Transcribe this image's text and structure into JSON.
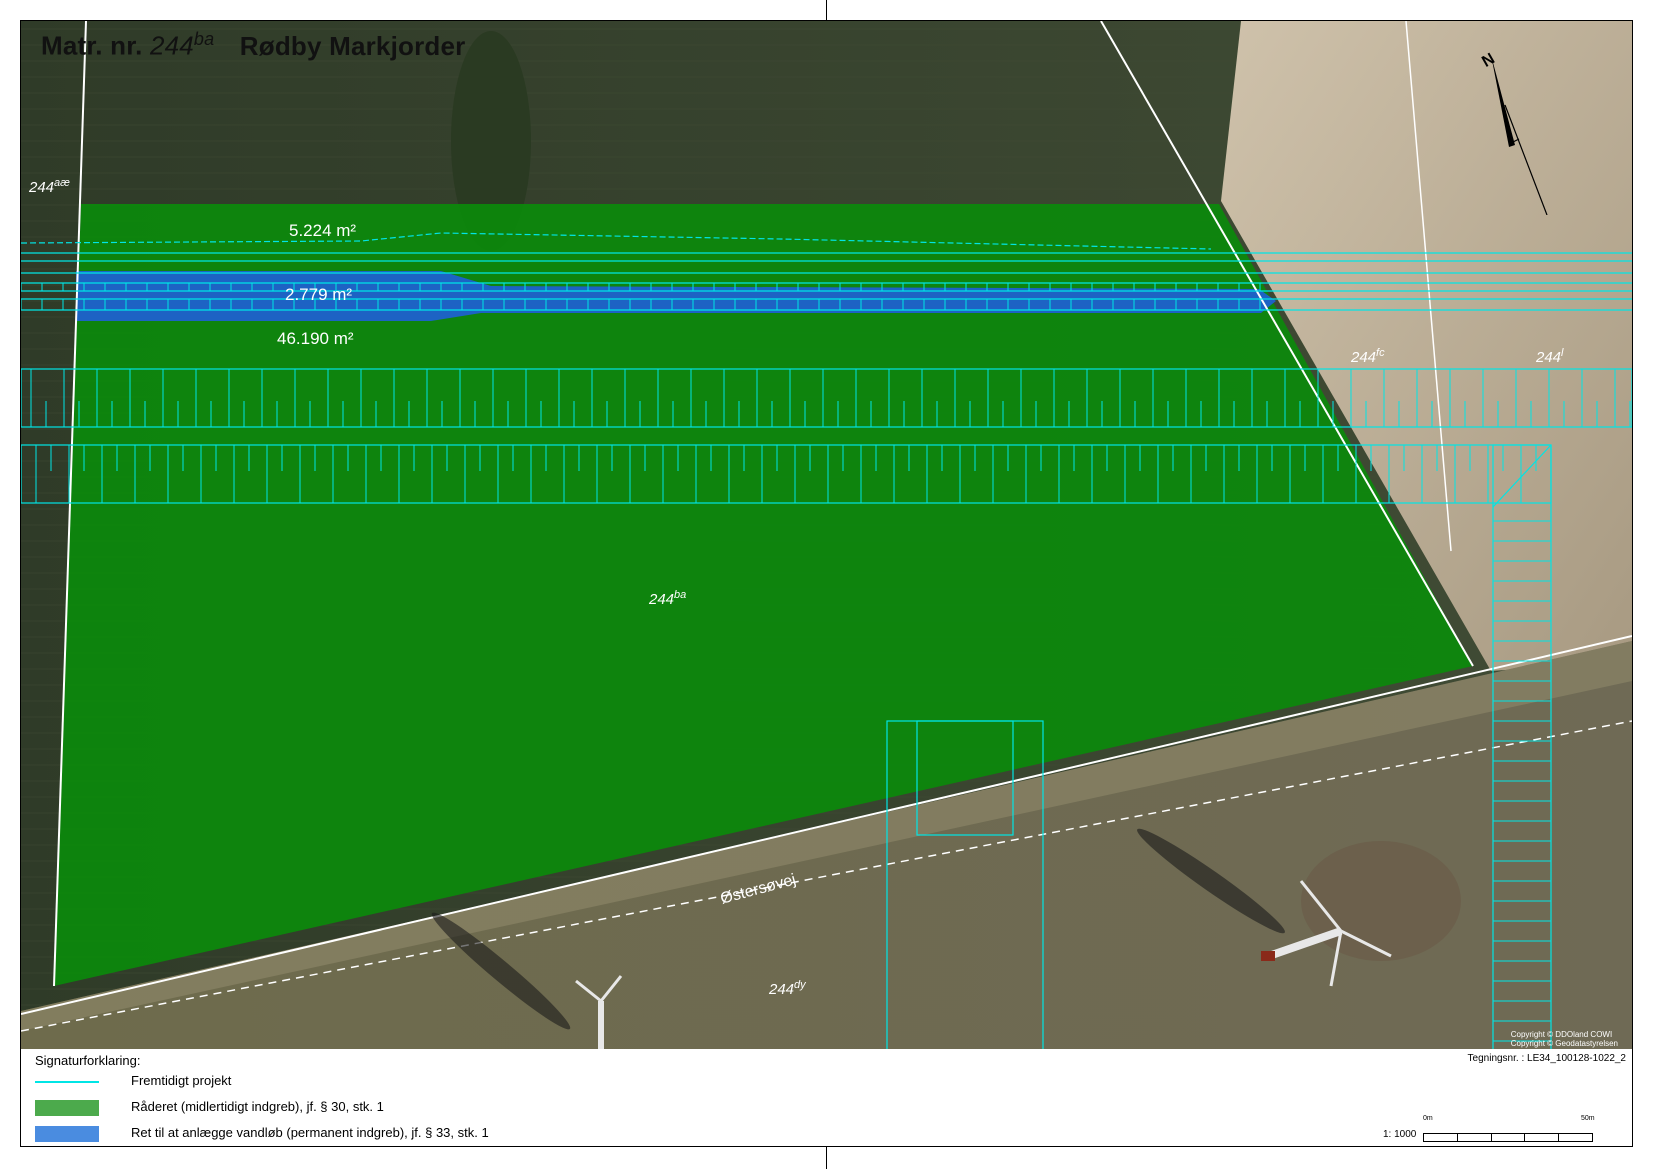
{
  "title": {
    "prefix": "Matr. nr.",
    "number": "244",
    "number_sup": "ba",
    "place": "Rødby Markjorder"
  },
  "parcels": [
    {
      "num": "244",
      "sup": "aæ"
    },
    {
      "num": "244",
      "sup": "fc"
    },
    {
      "num": "244",
      "sup": "l"
    },
    {
      "num": "244",
      "sup": "ba"
    },
    {
      "num": "244",
      "sup": "dy"
    }
  ],
  "areas": {
    "upper_strip": "5.224 m²",
    "watercourse": "2.779 m²",
    "main_field": "46.190 m²"
  },
  "road_name": "Østersøvej",
  "north_label": "N",
  "copyright": [
    "Copyright © DDOland COWI",
    "Copyright © Geodatastyrelsen"
  ],
  "legend": {
    "title": "Signaturforklaring:",
    "items": [
      {
        "label": "Fremtidigt projekt",
        "color": "#00e5e5",
        "kind": "line"
      },
      {
        "label": "Råderet (midlertidigt indgreb), jf. § 30, stk. 1",
        "color": "#4caa4c",
        "kind": "fill"
      },
      {
        "label": "Ret til at anlægge vandløb (permanent indgreb), jf. § 33, stk. 1",
        "color": "#4a8ce0",
        "kind": "fill"
      }
    ]
  },
  "drawing_number": "Tegningsnr. : LE34_100128-1022_2",
  "scale": {
    "label": "1: 1000",
    "start": "0m",
    "end": "50m"
  },
  "colors": {
    "project_line": "#00e5e5",
    "temporary_area": "#0b8a0b",
    "permanent_area": "#1f5fd8",
    "property_boundary": "#ffffff"
  }
}
